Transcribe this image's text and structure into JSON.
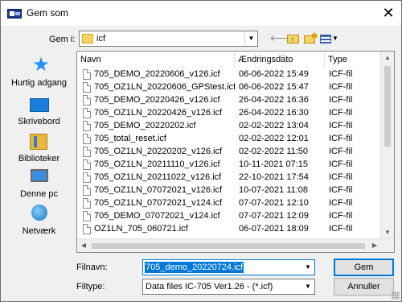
{
  "window": {
    "title": "Gem som",
    "close": "✕"
  },
  "save_in": {
    "label": "Gem i:",
    "value": "icf"
  },
  "toolbar": {
    "back_icon": "back-arrow-icon",
    "up_icon": "up-folder-icon",
    "new_folder_icon": "new-folder-icon",
    "views_icon": "view-menu-icon"
  },
  "places": [
    {
      "label": "Hurtig adgang",
      "icon": "star-icon"
    },
    {
      "label": "Skrivebord",
      "icon": "desktop-icon"
    },
    {
      "label": "Biblioteker",
      "icon": "libraries-icon"
    },
    {
      "label": "Denne pc",
      "icon": "computer-icon"
    },
    {
      "label": "Netværk",
      "icon": "network-icon"
    }
  ],
  "columns": {
    "name": "Navn",
    "date": "Ændringsdato",
    "type": "Type"
  },
  "files": [
    {
      "name": "705_DEMO_20220606_v126.icf",
      "date": "06-06-2022 15:49",
      "type": "ICF-fil"
    },
    {
      "name": "705_OZ1LN_20220606_GPStest.icf",
      "date": "06-06-2022 15:47",
      "type": "ICF-fil"
    },
    {
      "name": "705_DEMO_20220426_v126.icf",
      "date": "26-04-2022 16:36",
      "type": "ICF-fil"
    },
    {
      "name": "705_OZ1LN_20220426_v126.icf",
      "date": "26-04-2022 16:30",
      "type": "ICF-fil"
    },
    {
      "name": "705_DEMO_20220202.icf",
      "date": "02-02-2022 13:04",
      "type": "ICF-fil"
    },
    {
      "name": "705_total_reset.icf",
      "date": "02-02-2022 12:01",
      "type": "ICF-fil"
    },
    {
      "name": "705_OZ1LN_20220202_v126.icf",
      "date": "02-02-2022 11:50",
      "type": "ICF-fil"
    },
    {
      "name": "705_OZ1LN_20211110_v126.icf",
      "date": "10-11-2021 07:15",
      "type": "ICF-fil"
    },
    {
      "name": "705_OZ1LN_20211022_v126.icf",
      "date": "22-10-2021 17:54",
      "type": "ICF-fil"
    },
    {
      "name": "705_OZ1LN_07072021_v126.icf",
      "date": "10-07-2021 11:08",
      "type": "ICF-fil"
    },
    {
      "name": "705_OZ1LN_07072021_v124.icf",
      "date": "07-07-2021 12:10",
      "type": "ICF-fil"
    },
    {
      "name": "705_DEMO_07072021_v124.icf",
      "date": "07-07-2021 12:09",
      "type": "ICF-fil"
    },
    {
      "name": "OZ1LN_705_060721.icf",
      "date": "06-07-2021 18:09",
      "type": "ICF-fil"
    }
  ],
  "filename": {
    "label": "Filnavn:",
    "value": "705_demo_20220724.icf"
  },
  "filetype": {
    "label": "Filtype:",
    "value": "Data files IC-705 Ver1.26 - (*.icf)"
  },
  "buttons": {
    "save": "Gem",
    "cancel": "Annuller"
  }
}
